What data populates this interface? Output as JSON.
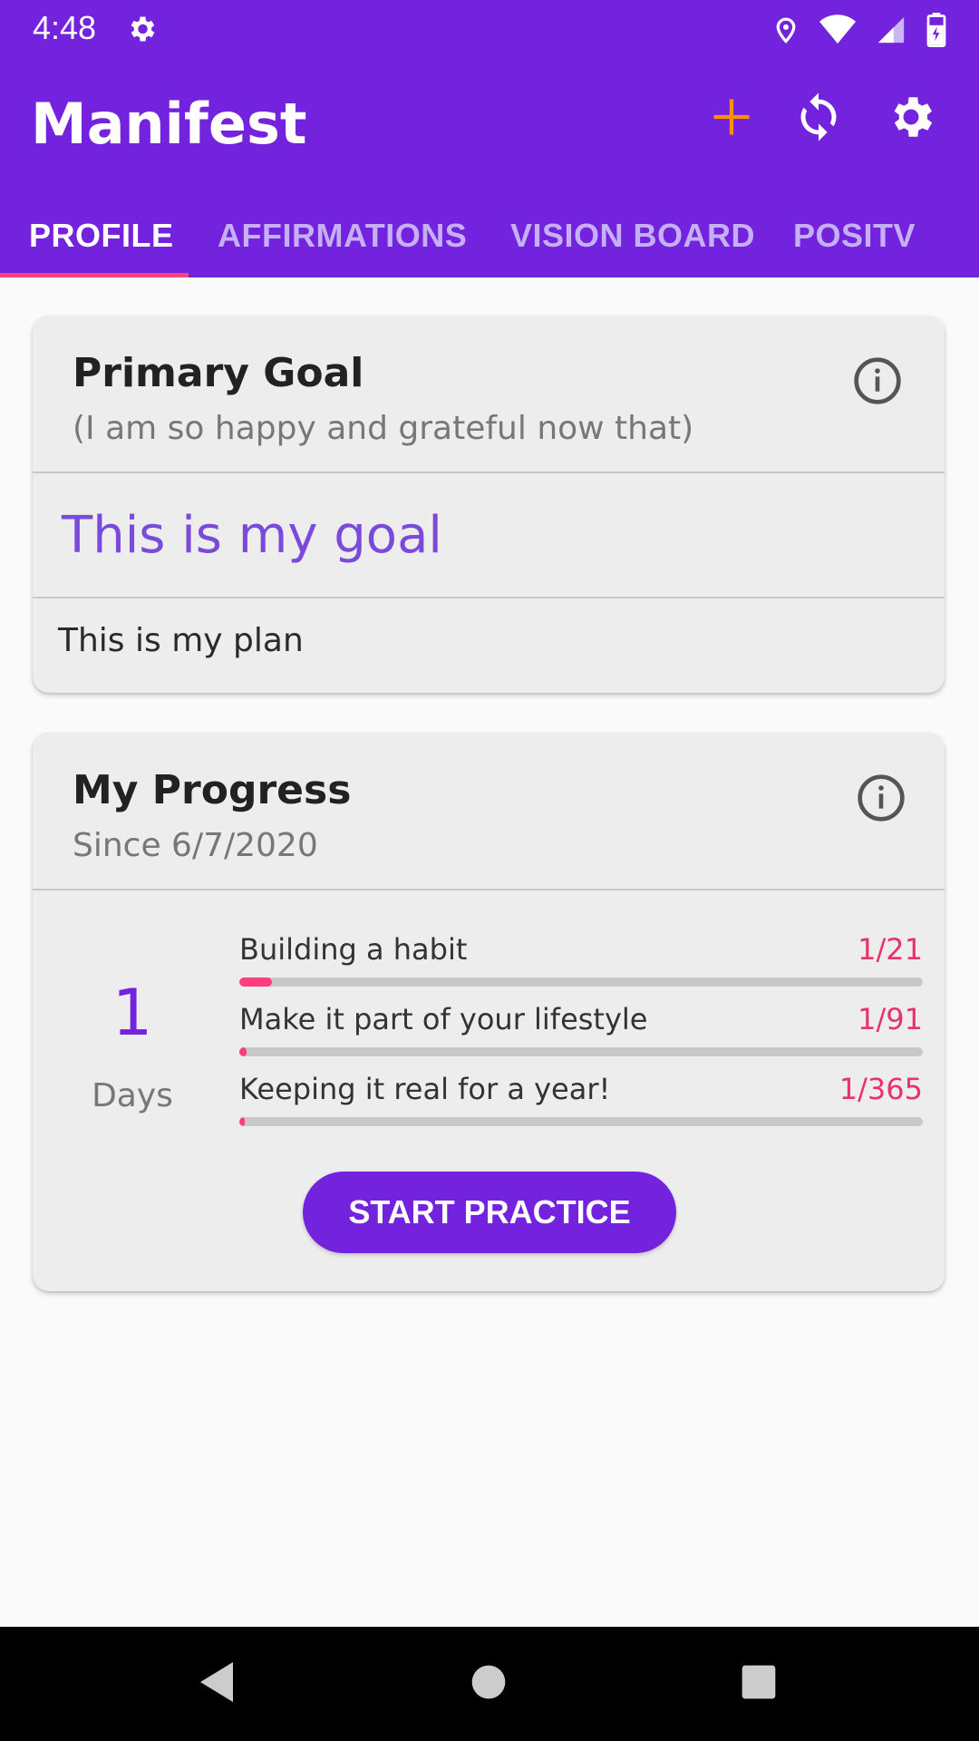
{
  "status_bar": {
    "time": "4:48",
    "icons": [
      "gear-icon",
      "location-icon",
      "wifi-icon",
      "signal-icon",
      "battery-charging-icon"
    ]
  },
  "app_bar": {
    "title": "Manifest",
    "actions": [
      "add-icon",
      "sync-icon",
      "settings-icon"
    ],
    "colors": {
      "primary": "#7322de",
      "accent": "#ff9100",
      "indicator": "#ff4081"
    }
  },
  "tabs": [
    {
      "label": "PROFILE",
      "active": true
    },
    {
      "label": "AFFIRMATIONS",
      "active": false
    },
    {
      "label": "VISION BOARD",
      "active": false
    },
    {
      "label": "POSITV",
      "active": false
    }
  ],
  "primary_goal": {
    "title": "Primary Goal",
    "subtitle": "(I am so happy and grateful now that)",
    "goal": "This is my goal",
    "plan": "This is my plan"
  },
  "progress": {
    "title": "My Progress",
    "subtitle": "Since 6/7/2020",
    "days_count": "1",
    "days_label": "Days",
    "items": [
      {
        "label": "Building a habit",
        "count": "1/21",
        "fraction": 0.0476
      },
      {
        "label": "Make it part of your lifestyle",
        "count": "1/91",
        "fraction": 0.011
      },
      {
        "label": "Keeping it real for a year!",
        "count": "1/365",
        "fraction": 0.0027
      }
    ],
    "button_label": "START PRACTICE"
  },
  "nav_bar": {
    "buttons": [
      "back-icon",
      "home-icon",
      "recents-icon"
    ]
  }
}
